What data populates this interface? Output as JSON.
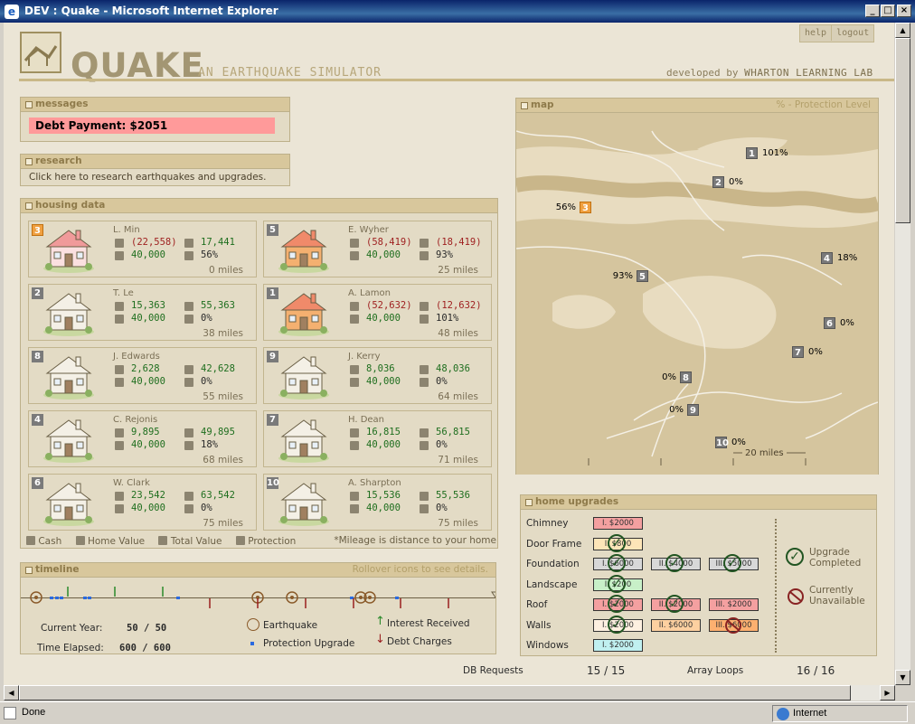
{
  "window": {
    "title": "DEV : Quake - Microsoft Internet Explorer"
  },
  "header": {
    "logo": "QUAKE",
    "subtitle": "AN EARTHQUAKE SIMULATOR",
    "developed_by": "developed by",
    "lab": "WHARTON LEARNING LAB",
    "help": "help",
    "logout": "logout"
  },
  "messages": {
    "title": "messages",
    "text": "Debt Payment: $2051"
  },
  "research": {
    "title": "research",
    "text": "Click here to research earthquakes and upgrades."
  },
  "housing": {
    "title": "housing data",
    "houses": [
      {
        "num": "3",
        "name": "L. Min",
        "cash": "(22,558)",
        "total": "17,441",
        "value": "40,000",
        "prot": "56%",
        "miles": "0 miles",
        "cash_neg": true,
        "total_neg": false,
        "color": "pink",
        "hl": true
      },
      {
        "num": "5",
        "name": "E. Wyher",
        "cash": "(58,419)",
        "total": "(18,419)",
        "value": "40,000",
        "prot": "93%",
        "miles": "25 miles",
        "cash_neg": true,
        "total_neg": true,
        "color": "orange",
        "hl": false
      },
      {
        "num": "2",
        "name": "T. Le",
        "cash": "15,363",
        "total": "55,363",
        "value": "40,000",
        "prot": "0%",
        "miles": "38 miles",
        "cash_neg": false,
        "total_neg": false,
        "color": "plain",
        "hl": false
      },
      {
        "num": "1",
        "name": "A. Lamon",
        "cash": "(52,632)",
        "total": "(12,632)",
        "value": "40,000",
        "prot": "101%",
        "miles": "48 miles",
        "cash_neg": true,
        "total_neg": true,
        "color": "orange",
        "hl": false
      },
      {
        "num": "8",
        "name": "J. Edwards",
        "cash": "2,628",
        "total": "42,628",
        "value": "40,000",
        "prot": "0%",
        "miles": "55 miles",
        "cash_neg": false,
        "total_neg": false,
        "color": "plain",
        "hl": false
      },
      {
        "num": "9",
        "name": "J. Kerry",
        "cash": "8,036",
        "total": "48,036",
        "value": "40,000",
        "prot": "0%",
        "miles": "64 miles",
        "cash_neg": false,
        "total_neg": false,
        "color": "plain",
        "hl": false
      },
      {
        "num": "4",
        "name": "C. Rejonis",
        "cash": "9,895",
        "total": "49,895",
        "value": "40,000",
        "prot": "18%",
        "miles": "68 miles",
        "cash_neg": false,
        "total_neg": false,
        "color": "plain",
        "hl": false
      },
      {
        "num": "7",
        "name": "H. Dean",
        "cash": "16,815",
        "total": "56,815",
        "value": "40,000",
        "prot": "0%",
        "miles": "71 miles",
        "cash_neg": false,
        "total_neg": false,
        "color": "plain",
        "hl": false
      },
      {
        "num": "6",
        "name": "W. Clark",
        "cash": "23,542",
        "total": "63,542",
        "value": "40,000",
        "prot": "0%",
        "miles": "75 miles",
        "cash_neg": false,
        "total_neg": false,
        "color": "plain",
        "hl": false
      },
      {
        "num": "10",
        "name": "A. Sharpton",
        "cash": "15,536",
        "total": "55,536",
        "value": "40,000",
        "prot": "0%",
        "miles": "75 miles",
        "cash_neg": false,
        "total_neg": false,
        "color": "plain",
        "hl": false
      }
    ],
    "legend": {
      "cash": "Cash",
      "home_value": "Home Value",
      "total_value": "Total Value",
      "protection": "Protection",
      "note": "*Mileage is distance to your home"
    }
  },
  "map": {
    "title": "map",
    "subtitle": "% - Protection Level",
    "scale": "20 miles",
    "markers": [
      {
        "num": "1",
        "label": "101%",
        "side": "right"
      },
      {
        "num": "2",
        "label": "0%",
        "side": "right"
      },
      {
        "num": "3",
        "label": "56%",
        "side": "left"
      },
      {
        "num": "4",
        "label": "18%",
        "side": "right"
      },
      {
        "num": "5",
        "label": "93%",
        "side": "left"
      },
      {
        "num": "6",
        "label": "0%",
        "side": "right"
      },
      {
        "num": "7",
        "label": "0%",
        "side": "right"
      },
      {
        "num": "8",
        "label": "0%",
        "side": "left"
      },
      {
        "num": "9",
        "label": "0%",
        "side": "left"
      },
      {
        "num": "10",
        "label": "0%",
        "side": "right"
      }
    ]
  },
  "upgrades": {
    "title": "home upgrades",
    "rows": [
      {
        "label": "Chimney",
        "boxes": [
          {
            "text": "I. $2000",
            "bg": "#f4a0a0",
            "mark": "none"
          }
        ]
      },
      {
        "label": "Door Frame",
        "boxes": [
          {
            "text": "I. $800",
            "bg": "#fde5b8",
            "mark": "check"
          }
        ]
      },
      {
        "label": "Foundation",
        "boxes": [
          {
            "text": "I. $6000",
            "bg": "#d8d8d8",
            "mark": "check"
          },
          {
            "text": "II. $4000",
            "bg": "#d8d8d8",
            "mark": "check"
          },
          {
            "text": "III. $5000",
            "bg": "#d8d8d8",
            "mark": "check"
          }
        ]
      },
      {
        "label": "Landscape",
        "boxes": [
          {
            "text": "I. $200",
            "bg": "#c8f0c8",
            "mark": "check"
          }
        ]
      },
      {
        "label": "Roof",
        "boxes": [
          {
            "text": "I. $2000",
            "bg": "#f4a0a0",
            "mark": "check"
          },
          {
            "text": "II. $2000",
            "bg": "#f4a0a0",
            "mark": "check"
          },
          {
            "text": "III. $2000",
            "bg": "#f4a0a0",
            "mark": "none"
          }
        ]
      },
      {
        "label": "Walls",
        "boxes": [
          {
            "text": "I. $2000",
            "bg": "#fdf0e0",
            "mark": "check"
          },
          {
            "text": "II. $6000",
            "bg": "#fdd0a0",
            "mark": "none"
          },
          {
            "text": "III. $6000",
            "bg": "#fdb070",
            "mark": "no"
          }
        ]
      },
      {
        "label": "Windows",
        "boxes": [
          {
            "text": "I. $2000",
            "bg": "#c0f0f0",
            "mark": "none"
          }
        ]
      }
    ],
    "legend": {
      "completed": "Upgrade Completed",
      "unavailable": "Currently Unavailable"
    }
  },
  "timeline": {
    "title": "timeline",
    "hint": "Rollover icons to see details.",
    "current_year_label": "Current Year:",
    "current_year": "50 / 50",
    "elapsed_label": "Time Elapsed:",
    "elapsed": "600 / 600",
    "legend": {
      "earthquake": "Earthquake",
      "protection": "Protection Upgrade",
      "interest": "Interest Received",
      "debt": "Debt Charges"
    }
  },
  "footer": {
    "db_label": "DB Requests",
    "db_value": "15 / 15",
    "loops_label": "Array Loops",
    "loops_value": "16 / 16"
  },
  "status": {
    "text": "Done",
    "zone": "Internet"
  }
}
